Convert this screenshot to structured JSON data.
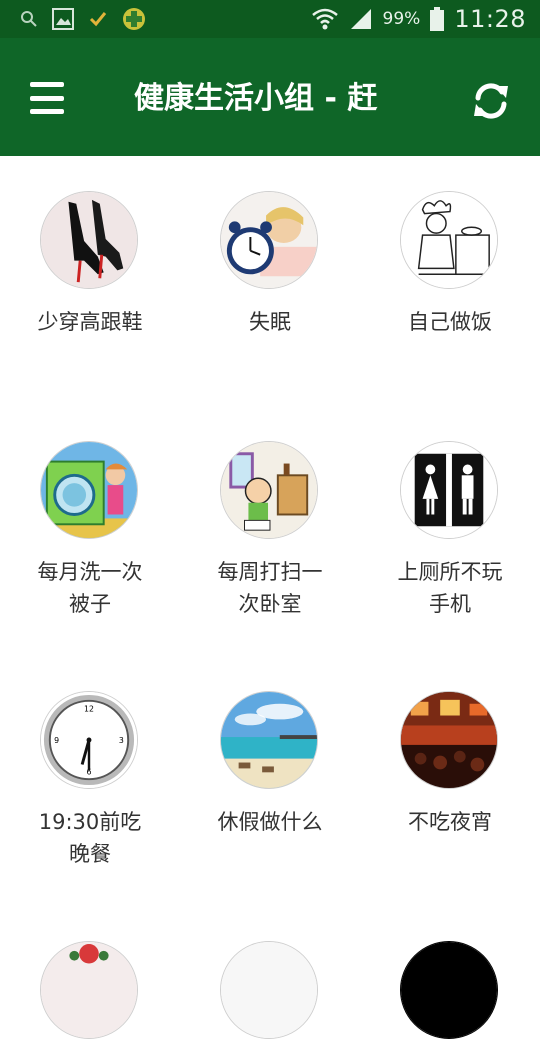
{
  "status_bar": {
    "battery": "99%",
    "time": "11:28",
    "icons": [
      "search-icon",
      "image-icon",
      "check-icon",
      "app-icon",
      "wifi-icon",
      "signal-icon",
      "battery-icon"
    ]
  },
  "app_bar": {
    "title": "健康生活小组 - 赶",
    "menu_icon": "hamburger-menu-icon",
    "refresh_icon": "refresh-icon",
    "color": "#0f6628"
  },
  "grid": {
    "items": [
      {
        "label": "少穿高跟鞋",
        "icon": "high-heels-image"
      },
      {
        "label": "失眠",
        "icon": "insomnia-image"
      },
      {
        "label": "自己做饭",
        "icon": "cooking-image"
      },
      {
        "label": "每月洗一次被子",
        "icon": "washing-machine-image"
      },
      {
        "label": "每周打扫一次卧室",
        "icon": "cleaning-room-image"
      },
      {
        "label": "上厕所不玩手机",
        "icon": "restroom-sign-image"
      },
      {
        "label": "19:30前吃晚餐",
        "icon": "clock-image"
      },
      {
        "label": "休假做什么",
        "icon": "beach-image"
      },
      {
        "label": "不吃夜宵",
        "icon": "night-market-image"
      }
    ]
  }
}
